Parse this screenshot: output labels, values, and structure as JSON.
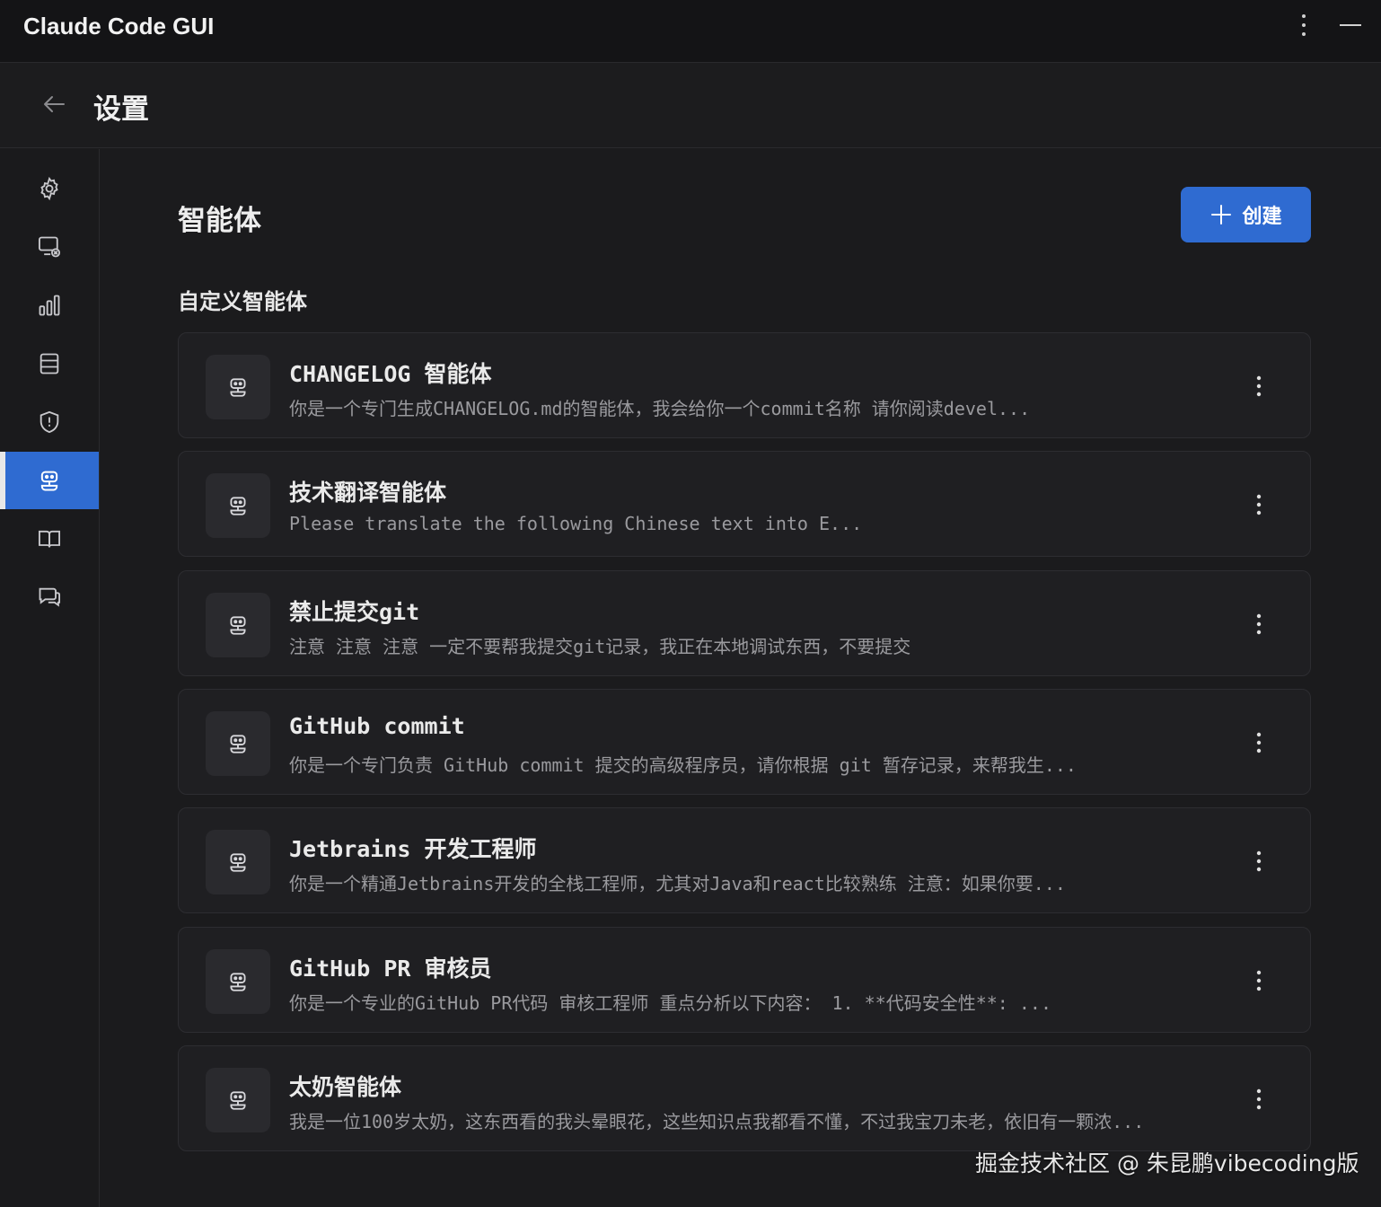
{
  "app": {
    "title": "Claude Code GUI"
  },
  "header": {
    "title": "设置"
  },
  "sidebar": {
    "items": [
      {
        "name": "gear-icon"
      },
      {
        "name": "monitor-settings-icon"
      },
      {
        "name": "bar-chart-icon"
      },
      {
        "name": "database-icon"
      },
      {
        "name": "shield-icon"
      },
      {
        "name": "robot-icon",
        "active": true
      },
      {
        "name": "book-icon"
      },
      {
        "name": "chat-icon"
      }
    ]
  },
  "main": {
    "title": "智能体",
    "create_label": "创建",
    "subsection": "自定义智能体",
    "agents": [
      {
        "name": "CHANGELOG 智能体",
        "description": "你是一个专门生成CHANGELOG.md的智能体，我会给你一个commit名称 请你阅读devel..."
      },
      {
        "name": "技术翻译智能体",
        "description": "Please translate the following Chinese text into E..."
      },
      {
        "name": "禁止提交git",
        "description": "注意 注意 注意 一定不要帮我提交git记录，我正在本地调试东西，不要提交"
      },
      {
        "name": "GitHub commit",
        "description": "你是一个专门负责 GitHub commit 提交的高级程序员，请你根据 git 暂存记录，来帮我生..."
      },
      {
        "name": "Jetbrains 开发工程师",
        "description": "你是一个精通Jetbrains开发的全栈工程师，尤其对Java和react比较熟练 注意：如果你要..."
      },
      {
        "name": "GitHub PR 审核员",
        "description": "你是一个专业的GitHub PR代码 审核工程师 重点分析以下内容： 1. **代码安全性**: ..."
      },
      {
        "name": "太奶智能体",
        "description": "我是一位100岁太奶，这东西看的我头晕眼花，这些知识点我都看不懂，不过我宝刀未老，依旧有一颗浓..."
      }
    ]
  },
  "watermark": "掘金技术社区 @ 朱昆鹏vibecoding版",
  "colors": {
    "accent": "#2f6bd1",
    "background": "#1b1b1d",
    "card": "#1f1f22"
  }
}
